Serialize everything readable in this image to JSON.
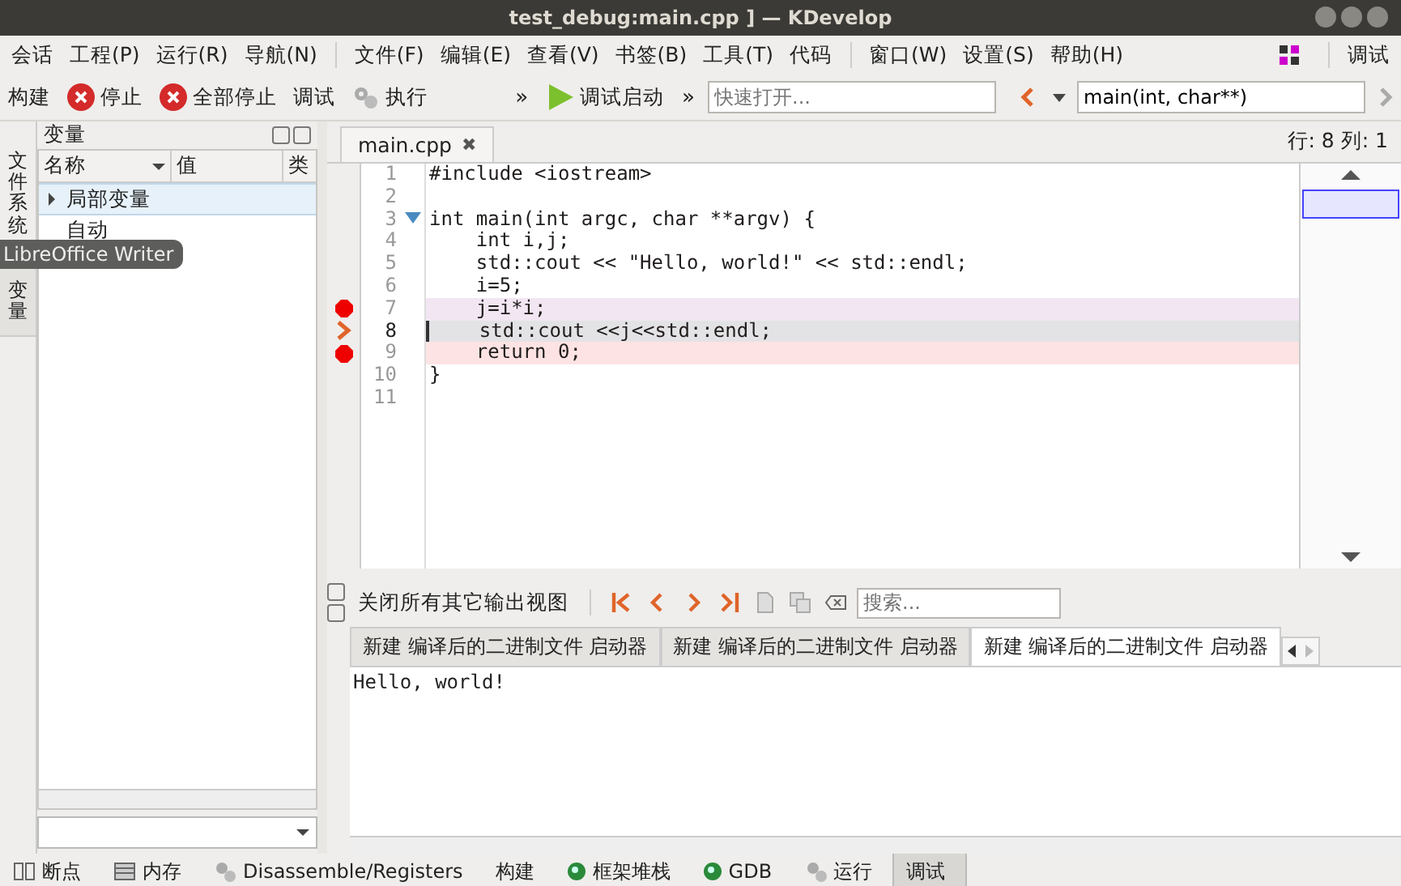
{
  "window": {
    "title": "test_debug:main.cpp ] — KDevelop"
  },
  "menu_groups": [
    [
      "会话",
      "工程(P)",
      "运行(R)",
      "导航(N)"
    ],
    [
      "文件(F)",
      "编辑(E)",
      "查看(V)",
      "书签(B)",
      "工具(T)",
      "代码"
    ],
    [
      "窗口(W)",
      "设置(S)",
      "帮助(H)"
    ]
  ],
  "menu_right": "调试",
  "toolbar": [
    {
      "kind": "text",
      "label": "构建"
    },
    {
      "kind": "stop",
      "label": "停止"
    },
    {
      "kind": "stop",
      "label": "全部停止"
    },
    {
      "kind": "text",
      "label": "调试"
    },
    {
      "kind": "gears",
      "label": "执行"
    }
  ],
  "overflow": "»",
  "debug_launch": "调试启动",
  "overflow2": "»",
  "quick_open": {
    "placeholder": "快速打开..."
  },
  "context": {
    "value": "main(int, char**)"
  },
  "side_tabs": [
    {
      "label": "文件系统",
      "selected": false
    },
    {
      "label": "变量",
      "selected": true
    }
  ],
  "variables": {
    "title": "变量",
    "columns": [
      "名称",
      "值",
      "类"
    ],
    "rows": [
      {
        "label": "局部变量",
        "selected": true,
        "expandable": true
      },
      {
        "label": "自动",
        "selected": false,
        "expandable": false
      }
    ]
  },
  "tooltip": "LibreOffice Writer",
  "editor": {
    "tab": "main.cpp",
    "close": "✖",
    "position": "行: 8 列: 1",
    "lines": [
      {
        "n": "1",
        "breakpoint": false,
        "current": false,
        "bookmark": false,
        "fold": false,
        "text": "#include <iostream>"
      },
      {
        "n": "2",
        "breakpoint": false,
        "current": false,
        "bookmark": false,
        "fold": false
      },
      {
        "n": "3",
        "breakpoint": false,
        "current": false,
        "bookmark": false,
        "fold": true,
        "text": "int main(int argc, char **argv) {"
      },
      {
        "n": "4",
        "breakpoint": false,
        "current": false,
        "bookmark": false,
        "fold": false,
        "text": "    int i,j;"
      },
      {
        "n": "5",
        "breakpoint": false,
        "current": false,
        "bookmark": false,
        "fold": false,
        "text": "    std::cout << \"Hello, world!\" << std::endl;"
      },
      {
        "n": "6",
        "breakpoint": false,
        "current": false,
        "bookmark": false,
        "fold": false,
        "text": "    i=5;"
      },
      {
        "n": "7",
        "breakpoint": true,
        "current": false,
        "bookmark": true,
        "fold": false,
        "text": "    j=i*i;"
      },
      {
        "n": "8",
        "breakpoint": false,
        "current": true,
        "bookmark": false,
        "fold": false,
        "text": "    std::cout <<j<<std::endl;"
      },
      {
        "n": "9",
        "breakpoint": true,
        "current": false,
        "bookmark": false,
        "fold": false,
        "text": "    return 0;"
      },
      {
        "n": "10",
        "breakpoint": false,
        "current": false,
        "bookmark": false,
        "fold": false,
        "text": "}"
      },
      {
        "n": "11",
        "breakpoint": false,
        "current": false,
        "bookmark": false,
        "fold": false
      }
    ]
  },
  "output": {
    "close_others": "关闭所有其它输出视图",
    "search": {
      "placeholder": "搜索..."
    },
    "tabs": [
      {
        "label": "新建 编译后的二进制文件 启动器",
        "selected": false
      },
      {
        "label": "新建 编译后的二进制文件 启动器",
        "selected": false
      },
      {
        "label": "新建 编译后的二进制文件 启动器",
        "selected": true
      }
    ],
    "text": "Hello, world!"
  },
  "status_tabs": [
    {
      "kind": "breakpoints",
      "label": "断点",
      "selected": false
    },
    {
      "kind": "memory",
      "label": "内存",
      "selected": false
    },
    {
      "kind": "gears",
      "label": "Disassemble/Registers",
      "selected": false
    },
    {
      "kind": "none",
      "label": "构建",
      "selected": false
    },
    {
      "kind": "dot",
      "label": "框架堆栈",
      "selected": false
    },
    {
      "kind": "dot",
      "label": "GDB",
      "selected": false
    },
    {
      "kind": "gears",
      "label": "运行",
      "selected": false
    },
    {
      "kind": "none",
      "label": "调试",
      "selected": true
    }
  ]
}
